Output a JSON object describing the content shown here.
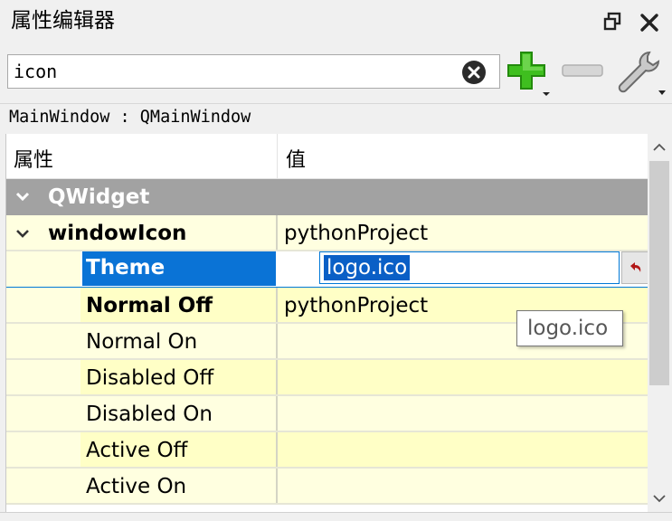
{
  "panel": {
    "title": "属性编辑器",
    "float_icon": "float-restore-icon",
    "close_icon": "close-icon"
  },
  "toolbar": {
    "filter_value": "icon",
    "clear_icon": "clear-circle-icon",
    "add_icon": "plus-icon",
    "remove_icon": "minus-icon",
    "config_icon": "wrench-icon"
  },
  "object_class": "MainWindow : QMainWindow",
  "tree": {
    "header_property": "属性",
    "header_value": "值",
    "group": "QWidget",
    "window_icon": {
      "name": "windowIcon",
      "value": "pythonProject"
    },
    "theme": {
      "name": "Theme",
      "editor_value": "logo.ico"
    },
    "normal_off": {
      "name": "Normal Off",
      "value": "pythonProject"
    },
    "normal_on": {
      "name": "Normal On"
    },
    "disabled_off": {
      "name": "Disabled Off"
    },
    "disabled_on": {
      "name": "Disabled On"
    },
    "active_off": {
      "name": "Active Off"
    },
    "active_on": {
      "name": "Active On"
    }
  },
  "tooltip": "logo.ico",
  "colors": {
    "selection": "#0a73d6",
    "group_bg": "#a2a2a2",
    "row_yellow": "#ffffe0"
  }
}
